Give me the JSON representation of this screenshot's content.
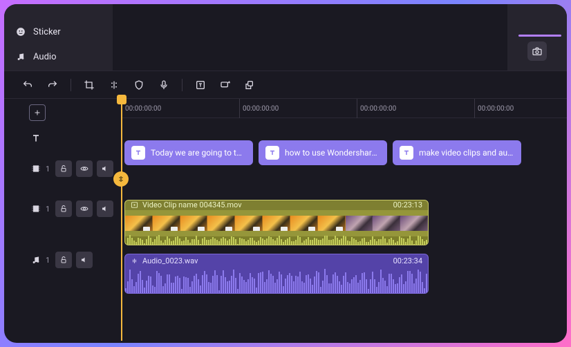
{
  "nav": {
    "sticker": "Sticker",
    "audio": "Audio"
  },
  "ruler": {
    "ticks": [
      "00:00:00:00",
      "00:00:00:00",
      "00:00:00:00",
      "00:00:00:00"
    ]
  },
  "text_clips": [
    {
      "label": "Today we are going to talk a..."
    },
    {
      "label": "how to use Wondershare De..."
    },
    {
      "label": "make video clips and autom..."
    }
  ],
  "video_clip": {
    "name": "Video Clip name 004345.mov",
    "duration": "00:23:13"
  },
  "audio_clip": {
    "name": "Audio_0023.wav",
    "duration": "00:23:34"
  },
  "track_counts": {
    "video1": "1",
    "video2": "1",
    "audio": "1"
  },
  "colors": {
    "accent": "#8c7aed",
    "playhead": "#f5b83d"
  }
}
